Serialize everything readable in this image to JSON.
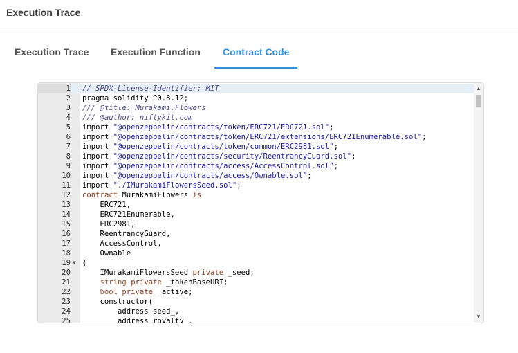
{
  "header": {
    "title": "Execution Trace"
  },
  "tabs": [
    {
      "label": "Execution Trace"
    },
    {
      "label": "Execution Function"
    },
    {
      "label": "Contract Code"
    }
  ],
  "active_tab": "Contract Code",
  "colors": {
    "accent": "#2f8fe0",
    "comment": "#4c4c8c",
    "string": "#1a1aa6",
    "keyword": "#8b3a1a"
  },
  "icons": {
    "fold": "chevron-down-icon",
    "scroll_up": "scroll-up-arrow-icon",
    "scroll_down": "scroll-down-arrow-icon"
  },
  "editor": {
    "active_line": 1,
    "fold_markers": [
      "19"
    ],
    "lines": [
      {
        "num": "1",
        "tokens": [
          {
            "c": "cm",
            "t": "// SPDX-License-Identifier: MIT"
          }
        ]
      },
      {
        "num": "2",
        "tokens": [
          {
            "c": "op",
            "t": "pragma solidity ^0.8.12;"
          }
        ]
      },
      {
        "num": "3",
        "tokens": [
          {
            "c": "cm",
            "t": "/// @title: Murakami.Flowers"
          }
        ]
      },
      {
        "num": "4",
        "tokens": [
          {
            "c": "cm",
            "t": "/// @author: niftykit.com"
          }
        ]
      },
      {
        "num": "5",
        "tokens": [
          {
            "c": "op",
            "t": "import "
          },
          {
            "c": "st",
            "t": "\"@openzeppelin/contracts/token/ERC721/ERC721.sol\""
          },
          {
            "c": "op",
            "t": ";"
          }
        ]
      },
      {
        "num": "6",
        "tokens": [
          {
            "c": "op",
            "t": "import "
          },
          {
            "c": "st",
            "t": "\"@openzeppelin/contracts/token/ERC721/extensions/ERC721Enumerable.sol\""
          },
          {
            "c": "op",
            "t": ";"
          }
        ]
      },
      {
        "num": "7",
        "tokens": [
          {
            "c": "op",
            "t": "import "
          },
          {
            "c": "st",
            "t": "\"@openzeppelin/contracts/token/common/ERC2981.sol\""
          },
          {
            "c": "op",
            "t": ";"
          }
        ]
      },
      {
        "num": "8",
        "tokens": [
          {
            "c": "op",
            "t": "import "
          },
          {
            "c": "st",
            "t": "\"@openzeppelin/contracts/security/ReentrancyGuard.sol\""
          },
          {
            "c": "op",
            "t": ";"
          }
        ]
      },
      {
        "num": "9",
        "tokens": [
          {
            "c": "op",
            "t": "import "
          },
          {
            "c": "st",
            "t": "\"@openzeppelin/contracts/access/AccessControl.sol\""
          },
          {
            "c": "op",
            "t": ";"
          }
        ]
      },
      {
        "num": "10",
        "tokens": [
          {
            "c": "op",
            "t": "import "
          },
          {
            "c": "st",
            "t": "\"@openzeppelin/contracts/access/Ownable.sol\""
          },
          {
            "c": "op",
            "t": ";"
          }
        ]
      },
      {
        "num": "11",
        "tokens": [
          {
            "c": "op",
            "t": "import "
          },
          {
            "c": "st",
            "t": "\"./IMurakamiFlowersSeed.sol\""
          },
          {
            "c": "op",
            "t": ";"
          }
        ]
      },
      {
        "num": "12",
        "tokens": [
          {
            "c": "kw",
            "t": "contract"
          },
          {
            "c": "op",
            "t": " MurakamiFlowers "
          },
          {
            "c": "kw",
            "t": "is"
          }
        ]
      },
      {
        "num": "13",
        "tokens": [
          {
            "c": "op",
            "t": "    ERC721,"
          }
        ]
      },
      {
        "num": "14",
        "tokens": [
          {
            "c": "op",
            "t": "    ERC721Enumerable,"
          }
        ]
      },
      {
        "num": "15",
        "tokens": [
          {
            "c": "op",
            "t": "    ERC2981,"
          }
        ]
      },
      {
        "num": "16",
        "tokens": [
          {
            "c": "op",
            "t": "    ReentrancyGuard,"
          }
        ]
      },
      {
        "num": "17",
        "tokens": [
          {
            "c": "op",
            "t": "    AccessControl,"
          }
        ]
      },
      {
        "num": "18",
        "tokens": [
          {
            "c": "op",
            "t": "    Ownable"
          }
        ]
      },
      {
        "num": "19",
        "tokens": [
          {
            "c": "op",
            "t": "{"
          }
        ]
      },
      {
        "num": "20",
        "tokens": [
          {
            "c": "op",
            "t": "    IMurakamiFlowersSeed "
          },
          {
            "c": "kw",
            "t": "private"
          },
          {
            "c": "op",
            "t": " _seed;"
          }
        ]
      },
      {
        "num": "21",
        "tokens": [
          {
            "c": "op",
            "t": "    "
          },
          {
            "c": "ty",
            "t": "string"
          },
          {
            "c": "op",
            "t": " "
          },
          {
            "c": "kw",
            "t": "private"
          },
          {
            "c": "op",
            "t": " _tokenBaseURI;"
          }
        ]
      },
      {
        "num": "22",
        "tokens": [
          {
            "c": "op",
            "t": "    "
          },
          {
            "c": "ty",
            "t": "bool"
          },
          {
            "c": "op",
            "t": " "
          },
          {
            "c": "kw",
            "t": "private"
          },
          {
            "c": "op",
            "t": " _active;"
          }
        ]
      },
      {
        "num": "23",
        "tokens": [
          {
            "c": "op",
            "t": "    constructor("
          }
        ]
      },
      {
        "num": "24",
        "tokens": [
          {
            "c": "op",
            "t": "        address seed_,"
          }
        ]
      },
      {
        "num": "25",
        "tokens": [
          {
            "c": "op",
            "t": "        address royalty_,"
          }
        ]
      }
    ]
  }
}
